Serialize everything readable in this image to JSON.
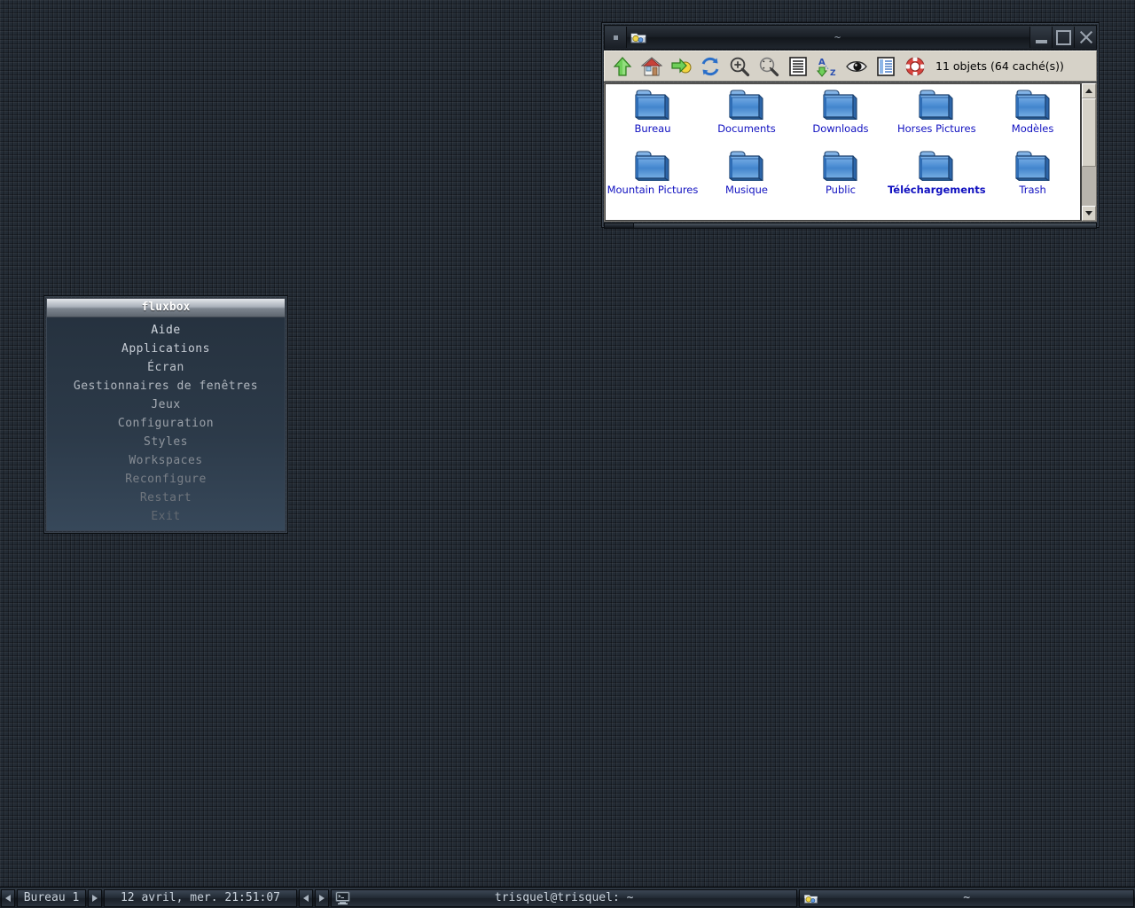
{
  "desktop": {
    "background_color": "#222a33"
  },
  "file_manager": {
    "window_title": "~",
    "title_icon": "folder-app-icon",
    "window_buttons": {
      "menu_label": "",
      "minimize_label": "Minimize",
      "maximize_label": "Maximize",
      "close_label": "Close"
    },
    "toolbar": {
      "buttons": [
        {
          "name": "up-icon",
          "tooltip": "Up"
        },
        {
          "name": "home-icon",
          "tooltip": "Home"
        },
        {
          "name": "go-to-icon",
          "tooltip": "Go to"
        },
        {
          "name": "refresh-icon",
          "tooltip": "Refresh"
        },
        {
          "name": "zoom-in-icon",
          "tooltip": "Zoom in"
        },
        {
          "name": "zoom-fit-icon",
          "tooltip": "Zoom fit"
        },
        {
          "name": "list-view-icon",
          "tooltip": "List view"
        },
        {
          "name": "sort-az-icon",
          "tooltip": "Sort A-Z"
        },
        {
          "name": "show-hidden-eye-icon",
          "tooltip": "Show hidden"
        },
        {
          "name": "detail-view-icon",
          "tooltip": "Detail view"
        },
        {
          "name": "help-lifering-icon",
          "tooltip": "Help"
        }
      ],
      "status_text": "11 objets (64 caché(s))"
    },
    "items": [
      {
        "label": "Bureau",
        "icon": "folder-icon",
        "selected": false
      },
      {
        "label": "Documents",
        "icon": "folder-icon",
        "selected": false
      },
      {
        "label": "Downloads",
        "icon": "folder-icon",
        "selected": false
      },
      {
        "label": "Horses Pictures",
        "icon": "folder-icon",
        "selected": false
      },
      {
        "label": "Modèles",
        "icon": "folder-icon",
        "selected": false
      },
      {
        "label": "Mountain Pictures",
        "icon": "folder-icon",
        "selected": false
      },
      {
        "label": "Musique",
        "icon": "folder-icon",
        "selected": false
      },
      {
        "label": "Public",
        "icon": "folder-icon",
        "selected": false
      },
      {
        "label": "Téléchargements",
        "icon": "folder-icon",
        "selected": true
      },
      {
        "label": "Trash",
        "icon": "folder-icon",
        "selected": false
      }
    ],
    "label_color": "#1010c0",
    "scrollbar": {
      "thumb_position_percent": 0,
      "thumb_size_percent": 62
    }
  },
  "fluxbox_menu": {
    "title": "fluxbox",
    "items": [
      {
        "label": "Aide"
      },
      {
        "label": "Applications"
      },
      {
        "label": "Écran"
      },
      {
        "label": "Gestionnaires de fenêtres"
      },
      {
        "label": "Jeux"
      },
      {
        "label": "Configuration"
      },
      {
        "label": "Styles"
      },
      {
        "label": "Workspaces"
      },
      {
        "label": "Reconfigure"
      },
      {
        "label": "Restart"
      },
      {
        "label": "Exit"
      }
    ]
  },
  "taskbar": {
    "workspace_prev_icon": "arrow-left-icon",
    "workspace_next_icon": "arrow-right-icon",
    "workspace_label": "Bureau 1",
    "clock": "12 avril, mer. 21:51:07",
    "task_prev_icon": "arrow-left-icon",
    "task_next_icon": "arrow-right-icon",
    "tasks": [
      {
        "label": "trisquel@trisquel: ~",
        "icon": "terminal-icon"
      },
      {
        "label": "~",
        "icon": "folder-app-icon"
      }
    ]
  }
}
